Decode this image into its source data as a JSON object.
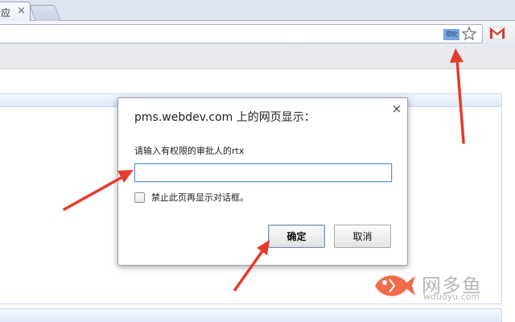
{
  "browser": {
    "tab_title": "应",
    "tab_close": "×",
    "omnibox_badge": "审批"
  },
  "dialog": {
    "title": "pms.webdev.com 上的网页显示：",
    "close": "×",
    "message": "请输入有权限的审批人的rtx",
    "input_value": "",
    "checkbox_label": "禁止此页再显示对话框。",
    "ok_label": "确定",
    "cancel_label": "取消"
  },
  "watermark": {
    "name": "网多鱼",
    "url": "wduoyu.com"
  },
  "colors": {
    "arrow": "#e53b2b",
    "gmail": "#d23f31",
    "fish": "#f26b4b"
  }
}
